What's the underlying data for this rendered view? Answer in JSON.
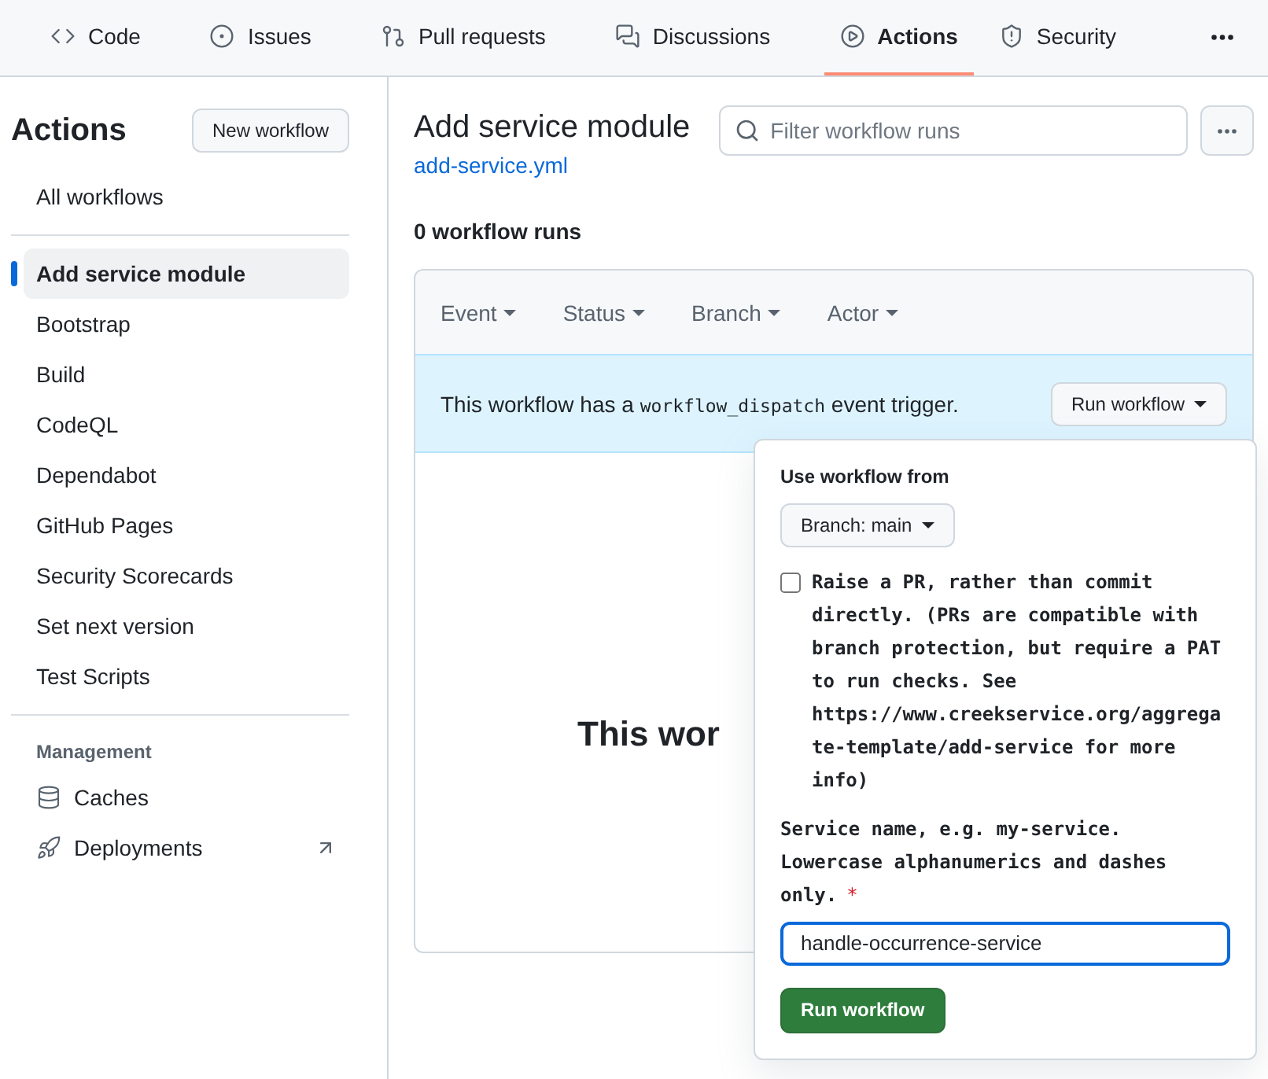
{
  "nav": {
    "tabs": [
      {
        "label": "Code",
        "kind": "code",
        "selected": false
      },
      {
        "label": "Issues",
        "kind": "issues",
        "selected": false
      },
      {
        "label": "Pull requests",
        "kind": "pulls",
        "selected": false
      },
      {
        "label": "Discussions",
        "kind": "discussions",
        "selected": false
      },
      {
        "label": "Actions",
        "kind": "actions",
        "selected": true
      },
      {
        "label": "Security",
        "kind": "security",
        "selected": false
      }
    ]
  },
  "sidebar": {
    "title": "Actions",
    "new_button": "New workflow",
    "all_workflows": "All workflows",
    "workflows": [
      {
        "label": "Add service module",
        "selected": true
      },
      {
        "label": "Bootstrap",
        "selected": false
      },
      {
        "label": "Build",
        "selected": false
      },
      {
        "label": "CodeQL",
        "selected": false
      },
      {
        "label": "Dependabot",
        "selected": false
      },
      {
        "label": "GitHub Pages",
        "selected": false
      },
      {
        "label": "Security Scorecards",
        "selected": false
      },
      {
        "label": "Set next version",
        "selected": false
      },
      {
        "label": "Test Scripts",
        "selected": false
      }
    ],
    "section": "Management",
    "management": [
      {
        "label": "Caches",
        "kind": "caches",
        "external": false
      },
      {
        "label": "Deployments",
        "kind": "deployments",
        "external": true
      }
    ]
  },
  "main": {
    "title": "Add service module",
    "file_link": "add-service.yml",
    "search": {
      "placeholder": "Filter workflow runs"
    },
    "count": "0 workflow runs",
    "filters": [
      "Event",
      "Status",
      "Branch",
      "Actor"
    ],
    "banner": {
      "before": "This workflow has a",
      "code": "workflow_dispatch",
      "after": "event trigger.",
      "button": "Run workflow"
    },
    "empty_title": "This wor",
    "popover": {
      "heading": "Use workflow from",
      "branch_button": "Branch: main",
      "checkbox": {
        "label": "Raise a PR, rather than commit directly. (PRs are compatible with branch protection, but require a PAT to run checks. See https://www.creekservice.org/aggregate-template/add-service for more info)",
        "checked": false
      },
      "input": {
        "label": "Service name, e.g. my-service. Lowercase alphanumerics and dashes only.",
        "required_mark": "*",
        "value": "handle-occurrence-service"
      },
      "submit": "Run workflow"
    }
  }
}
